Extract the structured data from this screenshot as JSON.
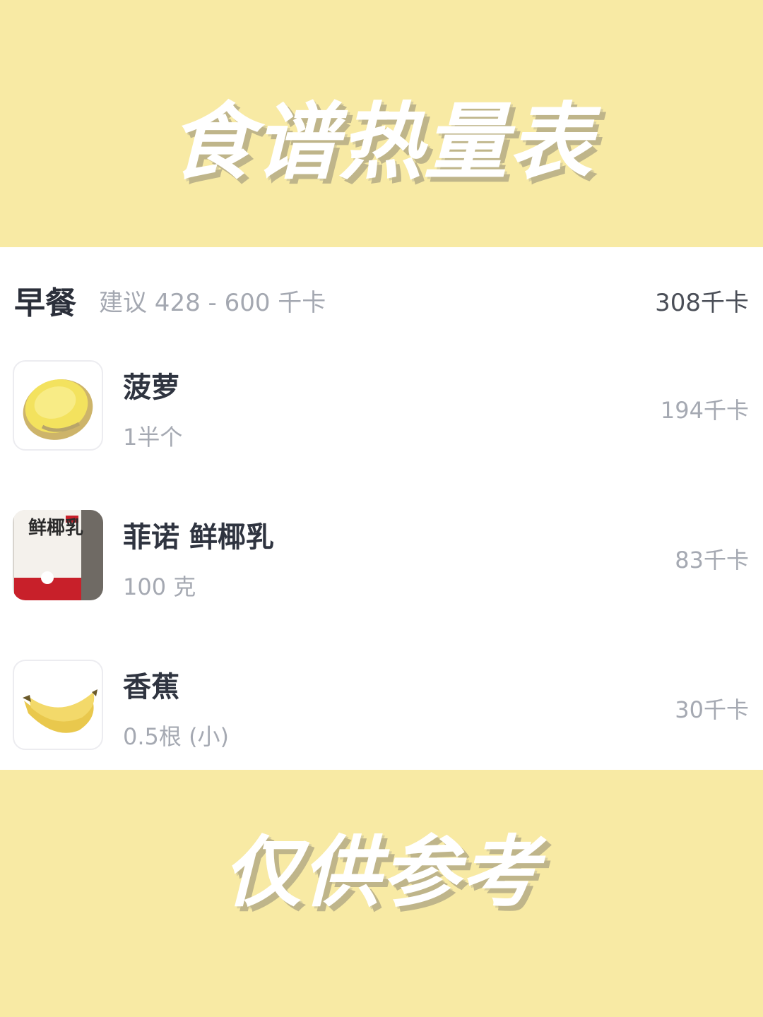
{
  "banner_top": {
    "title": "食谱热量表"
  },
  "meal": {
    "title": "早餐",
    "suggestion": "建议 428 - 600 千卡",
    "total": "308千卡",
    "items": [
      {
        "name": "菠萝",
        "quantity": "1半个",
        "calories": "194千卡",
        "icon": "pineapple-image"
      },
      {
        "name": "菲诺 鲜椰乳",
        "quantity": "100 克",
        "calories": "83千卡",
        "icon": "coconut-milk-carton-image",
        "package_text": "鲜椰乳"
      },
      {
        "name": "香蕉",
        "quantity": "0.5根 (小)",
        "calories": "30千卡",
        "icon": "banana-image"
      }
    ]
  },
  "banner_bottom": {
    "title": "仅供参考"
  }
}
